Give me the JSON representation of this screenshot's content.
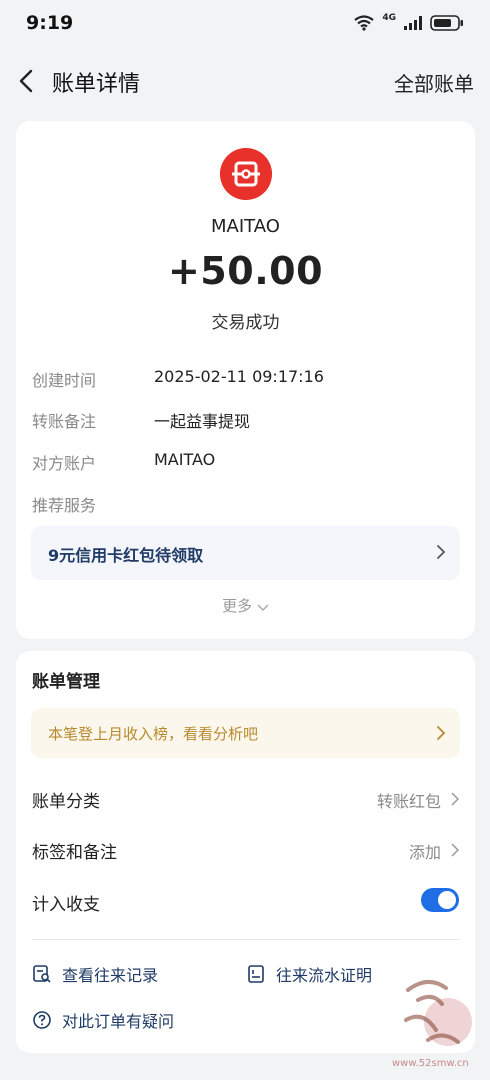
{
  "status": {
    "time": "9:19",
    "net": "4G"
  },
  "nav": {
    "title": "账单详情",
    "right": "全部账单"
  },
  "header": {
    "merchant": "MAITAO",
    "amount": "+50.00",
    "status": "交易成功"
  },
  "details": [
    {
      "key": "创建时间",
      "value": "2025-02-11 09:17:16"
    },
    {
      "key": "转账备注",
      "value": "一起益事提现"
    },
    {
      "key": "对方账户",
      "value": "MAITAO"
    },
    {
      "key": "推荐服务",
      "value": ""
    }
  ],
  "promo": {
    "text": "9元信用卡红包待领取"
  },
  "more": {
    "label": "更多"
  },
  "manage": {
    "title": "账单管理",
    "tip": "本笔登上月收入榜，看看分析吧",
    "category_label": "账单分类",
    "category_value": "转账红包",
    "tag_label": "标签和备注",
    "tag_value": "添加",
    "count_label": "计入收支",
    "count_enabled": true,
    "history": "查看往来记录",
    "statement": "往来流水证明",
    "question": "对此订单有疑问"
  },
  "watermark": {
    "site": "www.52smw.cn"
  },
  "colors": {
    "accent": "#1f6ee6",
    "logo": "#e8312a",
    "tip": "#b88a2e"
  }
}
